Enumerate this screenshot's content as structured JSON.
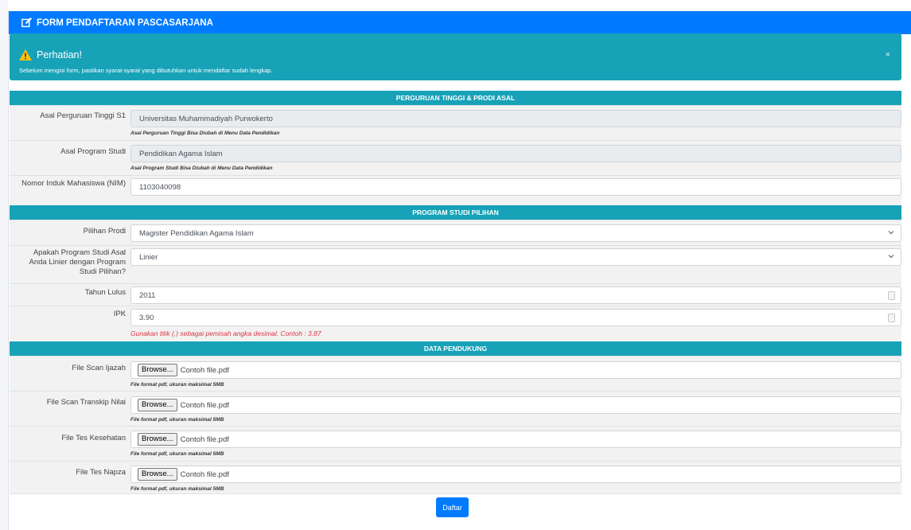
{
  "header": {
    "title": "FORM PENDAFTARAN PASCASARJANA",
    "icon": "edit-icon"
  },
  "alert": {
    "title": "Perhatian!",
    "message": "Sebelum mengisi form, pastikan syarat-syarat yang dibutuhkan untuk mendaftar sudah lengkap.",
    "close": "×",
    "color": "#17a2b8"
  },
  "sections": {
    "asal": "PERGURUAN TINGGI & PRODI ASAL",
    "pilihan": "PROGRAM STUDI PILIHAN",
    "pendukung": "DATA PENDUKUNG"
  },
  "colon": ":",
  "asal": {
    "pt_label": "Asal Perguruan Tinggi S1",
    "pt_value": "Universitas Muhammadiyah Purwokerto",
    "pt_hint": "Asal Perguruan Tinggi Bisa Diubah di Menu Data Pendidikan",
    "prodi_label": "Asal Program Studi",
    "prodi_value": "Pendidikan Agama Islam",
    "prodi_hint": "Asal Program Studi Bisa Diubah di Menu Data Pendidikan",
    "nim_label": "Nomor Induk Mahasiswa (NIM)",
    "nim_value": "1103040098"
  },
  "pilihan": {
    "prodi_label": "Pilihan Prodi",
    "prodi_value": "Magister Pendidikan Agama Islam",
    "linier_label": "Apakah Program Studi Asal Anda Linier dengan Program Studi Pilihan?",
    "linier_value": "Linier",
    "lulus_label": "Tahun Lulus",
    "lulus_value": "2011",
    "ipk_label": "IPK",
    "ipk_value": "3.90",
    "ipk_hint": "Gunakan titik (.) sebagai pemisah angka desimal. Contoh : 3.87"
  },
  "pendukung": {
    "browse": "Browse...",
    "file_name": "Contoh file.pdf",
    "hint": "File format pdf, ukuran maksimal 5MB",
    "files": [
      {
        "label": "File Scan Ijazah"
      },
      {
        "label": "File Scan Transkip Nilai"
      },
      {
        "label": "File Tes Kesehatan"
      },
      {
        "label": "File Tes Napza"
      }
    ]
  },
  "submit": "Daftar",
  "colors": {
    "primary": "#007bff",
    "info": "#17a2b8",
    "danger": "#dc3545"
  }
}
